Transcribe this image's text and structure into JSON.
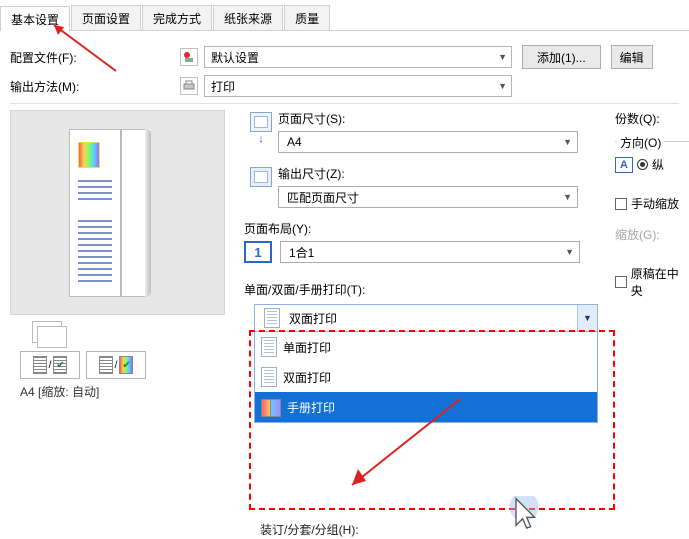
{
  "tabs": [
    "基本设置",
    "页面设置",
    "完成方式",
    "纸张来源",
    "质量"
  ],
  "profile": {
    "label": "配置文件(F):",
    "value": "默认设置"
  },
  "buttons": {
    "add": "添加(1)...",
    "edit": "编辑"
  },
  "output": {
    "label": "输出方法(M):",
    "value": "打印"
  },
  "page_size": {
    "label": "页面尺寸(S):",
    "value": "A4"
  },
  "output_size": {
    "label": "输出尺寸(Z):",
    "value": "匹配页面尺寸"
  },
  "layout": {
    "label": "页面布局(Y):",
    "value": "1合1",
    "num": "1"
  },
  "duplex": {
    "label": "单面/双面/手册打印(T):",
    "value": "双面打印",
    "options": [
      "单面打印",
      "双面打印",
      "手册打印"
    ]
  },
  "binding_label": "装订/分套/分组(H):",
  "preview_caption": "A4 [缩放: 自动]",
  "right": {
    "copies": "份数(Q):",
    "orientation": "方向(O)",
    "portrait": "纵",
    "manual_scale": "手动缩放",
    "scaling": "缩放(G):",
    "original_center": "原稿在中央"
  }
}
